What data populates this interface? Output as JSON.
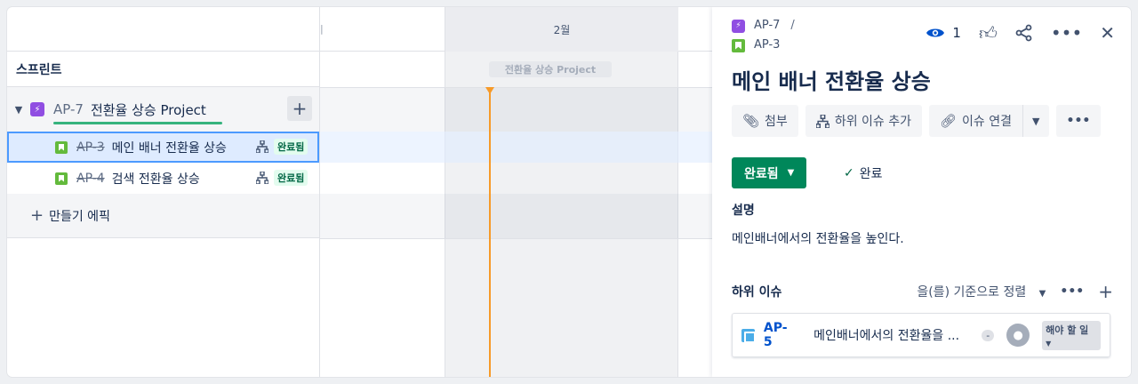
{
  "left": {
    "header_label": "스프린트",
    "epic": {
      "key": "AP-7",
      "name": "전환율 상승 Project",
      "add_label": "+"
    },
    "issues": [
      {
        "key": "AP-3",
        "name": "메인 배너 전환율 상승",
        "status": "완료됨"
      },
      {
        "key": "AP-4",
        "name": "검색 전환율 상승",
        "status": "완료됨"
      }
    ],
    "make_epic_label": "만들기 에픽"
  },
  "timeline": {
    "month": "2월",
    "sprint_chip": "전환율 상승 Project"
  },
  "detail": {
    "crumb_parent": "AP-7",
    "crumb_separator": "/",
    "crumb_current": "AP-3",
    "watchers": "1",
    "title": "메인 배너 전환율 상승",
    "buttons": {
      "attach": "첨부",
      "add_child": "하위 이슈 추가",
      "link_issue": "이슈 연결"
    },
    "status": "완료됨",
    "resolution": "완료",
    "description_heading": "설명",
    "description": "메인배너에서의 전환율을 높인다.",
    "subtasks_heading": "하위 이슈",
    "sort_label": "을(를) 기준으로 정렬",
    "subtask": {
      "key": "AP-5",
      "name": "메인배너에서의 전환율을 ...",
      "priority": "-",
      "status": "해야 할 일"
    }
  }
}
